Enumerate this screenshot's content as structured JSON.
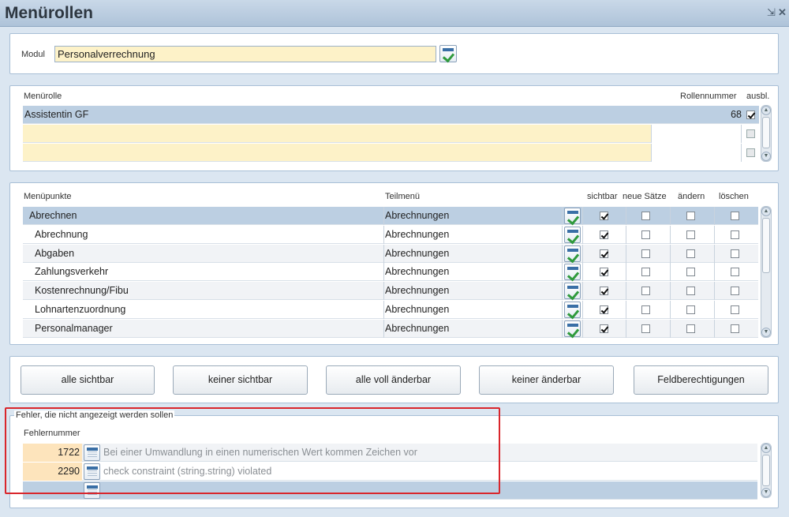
{
  "window": {
    "title": "Menürollen",
    "minimize_glyph": "⇲",
    "close_glyph": "✕"
  },
  "modul": {
    "label": "Modul",
    "value": "Personalverrechnung"
  },
  "menurolle": {
    "header_label": "Menürolle",
    "header_rollennummer": "Rollennummer",
    "header_ausbl": "ausbl.",
    "rows": [
      {
        "name": "Assistentin GF",
        "nummer": "68",
        "ausbl": true
      },
      {
        "name": "",
        "nummer": "",
        "ausbl": false
      },
      {
        "name": "",
        "nummer": "",
        "ausbl": false
      }
    ]
  },
  "menupunkte": {
    "headers": {
      "menupunkte": "Menüpunkte",
      "teilmenu": "Teilmenü",
      "sichtbar": "sichtbar",
      "neue_saetze": "neue Sätze",
      "aendern": "ändern",
      "loeschen": "löschen"
    },
    "rows": [
      {
        "name": "Abrechnen",
        "teilmenu": "Abrechnungen",
        "sichtbar": true,
        "neue": false,
        "aendern": false,
        "loeschen": false
      },
      {
        "name": "Abrechnung",
        "teilmenu": "Abrechnungen",
        "sichtbar": true,
        "neue": false,
        "aendern": false,
        "loeschen": false
      },
      {
        "name": "Abgaben",
        "teilmenu": "Abrechnungen",
        "sichtbar": true,
        "neue": false,
        "aendern": false,
        "loeschen": false
      },
      {
        "name": "Zahlungsverkehr",
        "teilmenu": "Abrechnungen",
        "sichtbar": true,
        "neue": false,
        "aendern": false,
        "loeschen": false
      },
      {
        "name": "Kostenrechnung/Fibu",
        "teilmenu": "Abrechnungen",
        "sichtbar": true,
        "neue": false,
        "aendern": false,
        "loeschen": false
      },
      {
        "name": "Lohnartenzuordnung",
        "teilmenu": "Abrechnungen",
        "sichtbar": true,
        "neue": false,
        "aendern": false,
        "loeschen": false
      },
      {
        "name": "Personalmanager",
        "teilmenu": "Abrechnungen",
        "sichtbar": true,
        "neue": false,
        "aendern": false,
        "loeschen": false
      }
    ]
  },
  "buttons": {
    "alle_sichtbar": "alle sichtbar",
    "keiner_sichtbar": "keiner sichtbar",
    "alle_voll": "alle voll änderbar",
    "keiner_aenderbar": "keiner änderbar",
    "feldberechtigungen": "Feldberechtigungen"
  },
  "fehler": {
    "legend": "Fehler, die nicht angezeigt werden sollen",
    "header": "Fehlernummer",
    "rows": [
      {
        "nummer": "1722",
        "text": "Bei einer Umwandlung in einen numerischen Wert kommen Zeichen vor"
      },
      {
        "nummer": "2290",
        "text": "check constraint (string.string) violated"
      }
    ]
  },
  "icons": [
    "calendar-check-icon",
    "calendar-icon",
    "checkbox-icon",
    "scroll-up-icon",
    "scroll-down-icon",
    "close-icon",
    "minimize-icon"
  ],
  "colors": {
    "selected_row": "#bccfe2",
    "input_bg": "#fdf2c8",
    "highlight_border": "#d9262c",
    "titlebar": "#aec3d9"
  }
}
